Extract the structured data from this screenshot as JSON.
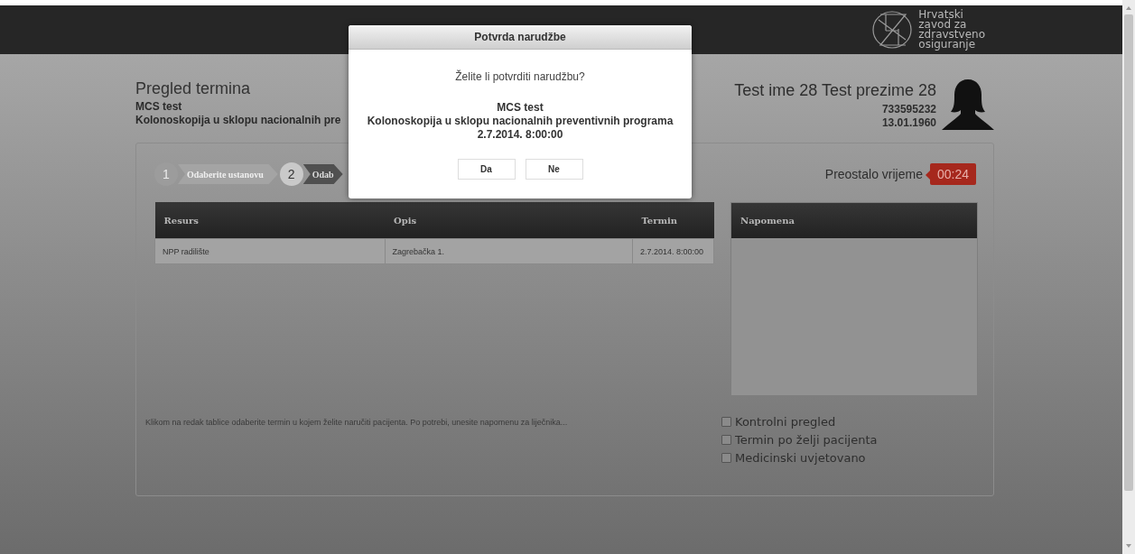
{
  "header": {
    "logo_lines": [
      "Hrvatski",
      "zavod za",
      "zdravstveno",
      "osiguranje"
    ]
  },
  "page": {
    "title": "Pregled termina",
    "subtitle": "MCS test",
    "service": "Kolonoskopija u sklopu nacionalnih pre"
  },
  "patient": {
    "name": "Test ime 28 Test prezime 28",
    "id": "733595232",
    "birth_date": "13.01.1960"
  },
  "steps": [
    {
      "number": "1",
      "label": "Odaberite ustanovu",
      "selected": false
    },
    {
      "number": "2",
      "label": "Odab",
      "selected": true
    }
  ],
  "timer": {
    "label": "Preostalo vrijeme",
    "value": "00:24"
  },
  "table": {
    "columns": [
      "Resurs",
      "Opis",
      "Termin"
    ],
    "rows": [
      [
        "NPP radilište",
        "Zagrebačka 1.",
        "2.7.2014. 8:00:00"
      ]
    ]
  },
  "note": {
    "heading": "Napomena"
  },
  "hint": "Klikom na redak tablice odaberite termin u kojem želite naručiti pacijenta. Po potrebi, unesite napomenu za liječnika...",
  "options": [
    {
      "label": "Kontrolni pregled",
      "checked": false
    },
    {
      "label": "Termin po želji pacijenta",
      "checked": false
    },
    {
      "label": "Medicinski uvjetovano",
      "checked": false
    }
  ],
  "dialog": {
    "title": "Potvrda narudžbe",
    "question": "Želite li potvrditi narudžbu?",
    "details": [
      "MCS test",
      "Kolonoskopija u sklopu nacionalnih preventivnih programa",
      "2.7.2014. 8:00:00"
    ],
    "buttons": [
      "Da",
      "Ne"
    ]
  }
}
